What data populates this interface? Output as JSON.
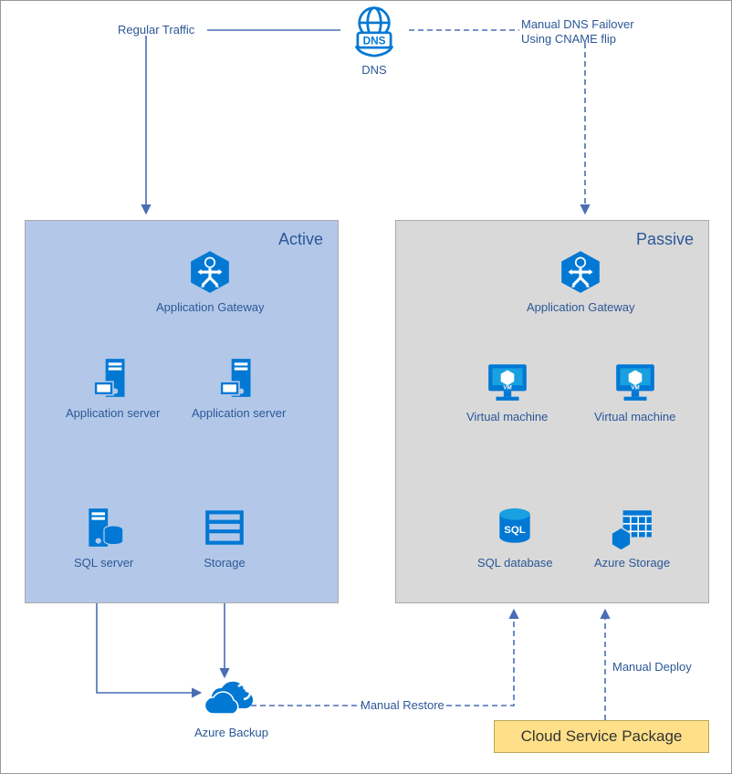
{
  "dns": {
    "label": "DNS",
    "bubble_text": "DNS"
  },
  "edges": {
    "regular_traffic": "Regular Traffic",
    "failover_line1": "Manual DNS Failover",
    "failover_line2": "Using CNAME flip",
    "manual_restore": "Manual Restore",
    "manual_deploy": "Manual Deploy"
  },
  "active": {
    "title": "Active",
    "app_gateway": "Application Gateway",
    "app_server_1": "Application server",
    "app_server_2": "Application server",
    "sql_server": "SQL server",
    "storage": "Storage"
  },
  "passive": {
    "title": "Passive",
    "app_gateway": "Application Gateway",
    "vm_1": "Virtual machine",
    "vm_2": "Virtual machine",
    "sql_db": "SQL database",
    "azure_storage": "Azure Storage"
  },
  "azure_backup": "Azure Backup",
  "cloud_service_package": "Cloud Service Package",
  "colors": {
    "azure_blue": "#0078d4",
    "line": "#4a6db5",
    "active_bg": "#b3c8e8",
    "passive_bg": "#d9d9d9",
    "package_bg": "#ffe089"
  }
}
